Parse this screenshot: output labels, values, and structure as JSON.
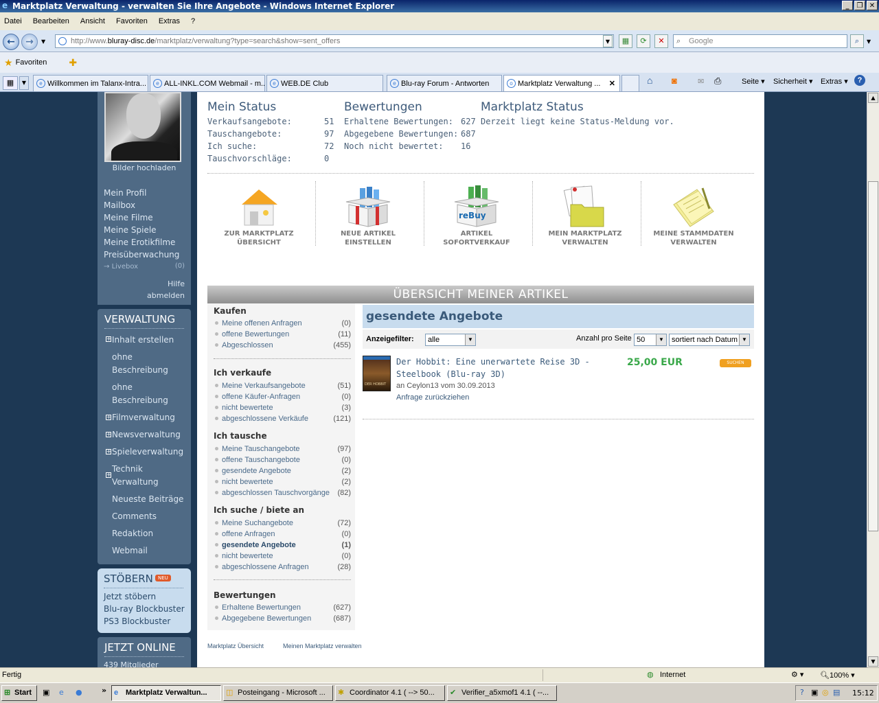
{
  "window": {
    "title": "Marktplatz Verwaltung - verwalten Sie Ihre Angebote - Windows Internet Explorer"
  },
  "menu": [
    "Datei",
    "Bearbeiten",
    "Ansicht",
    "Favoriten",
    "Extras",
    "?"
  ],
  "address": {
    "prefix": "http://www.",
    "domain": "bluray-disc.de",
    "path": "/marktplatz/verwaltung?type=search&show=sent_offers",
    "search_placeholder": "Google"
  },
  "favorites": {
    "label": "Favoriten"
  },
  "tabs": [
    {
      "label": "Willkommen im Talanx-Intra..."
    },
    {
      "label": "ALL-INKL.COM Webmail - m..."
    },
    {
      "label": "WEB.DE Club"
    },
    {
      "label": "Blu-ray Forum - Antworten"
    },
    {
      "label": "Marktplatz Verwaltung ..."
    }
  ],
  "commands": {
    "seite": "Seite",
    "sicherheit": "Sicherheit",
    "extras": "Extras"
  },
  "sidebar": {
    "upload": "Bilder hochladen",
    "links": [
      "Mein Profil",
      "Mailbox",
      "Meine Filme",
      "Meine Spiele",
      "Meine Erotikfilme",
      "Preisüberwachung"
    ],
    "livebox": "Livebox",
    "livebox_count": "(0)",
    "hilfe": "Hilfe",
    "abmelden": "abmelden",
    "verwaltung_title": "VERWALTUNG",
    "verwaltung": [
      "Inhalt erstellen",
      "ohne Beschreibung",
      "ohne Beschreibung",
      "Filmverwaltung",
      "Newsverwaltung",
      "Spieleverwaltung",
      "Technik Verwaltung",
      "Neueste Beiträge",
      "Comments",
      "Redaktion",
      "Webmail"
    ],
    "stoebern_title": "STÖBERN",
    "neu_badge": "NEU",
    "stoebern": [
      "Jetzt stöbern",
      "Blu-ray Blockbuster",
      "PS3 Blockbuster"
    ],
    "online_title": "JETZT ONLINE",
    "online_members": "439 Mitglieder"
  },
  "status": {
    "mein_title": "Mein Status",
    "mein": [
      {
        "label": "Verkaufsangebote:",
        "value": "51"
      },
      {
        "label": "Tauschangebote:",
        "value": "97"
      },
      {
        "label": "Ich suche:",
        "value": "72"
      },
      {
        "label": "Tauschvorschläge:",
        "value": "0"
      }
    ],
    "bew_title": "Bewertungen",
    "bew": [
      {
        "label": "Erhaltene Bewertungen:",
        "value": "627"
      },
      {
        "label": "Abgegebene Bewertungen:",
        "value": "687"
      },
      {
        "label": "Noch nicht bewertet:",
        "value": "16"
      }
    ],
    "mp_title": "Marktplatz Status",
    "mp_text": "Derzeit liegt keine Status-Meldung vor."
  },
  "icons": [
    {
      "line1": "ZUR MARKTPLATZ",
      "line2": "ÜBERSICHT"
    },
    {
      "line1": "NEUE ARTIKEL",
      "line2": "EINSTELLEN"
    },
    {
      "line1": "ARTIKEL",
      "line2": "SOFORTVERKAUF"
    },
    {
      "line1": "MEIN MARKTPLATZ",
      "line2": "VERWALTEN"
    },
    {
      "line1": "MEINE STAMMDATEN",
      "line2": "VERWALTEN"
    }
  ],
  "rebuy_logo": "reBuy",
  "overview_title": "ÜBERSICHT MEINER ARTIKEL",
  "lists": {
    "kaufen_title": "Kaufen",
    "kaufen": [
      {
        "label": "Meine offenen Anfragen",
        "count": "(0)"
      },
      {
        "label": "offene Bewertungen",
        "count": "(11)"
      },
      {
        "label": "Abgeschlossen",
        "count": "(455)"
      }
    ],
    "verkaufe_title": "Ich verkaufe",
    "verkaufe": [
      {
        "label": "Meine Verkaufsangebote",
        "count": "(51)"
      },
      {
        "label": "offene Käufer-Anfragen",
        "count": "(0)"
      },
      {
        "label": "nicht bewertete",
        "count": "(3)"
      },
      {
        "label": "abgeschlossene Verkäufe",
        "count": "(121)"
      }
    ],
    "tausche_title": "Ich tausche",
    "tausche": [
      {
        "label": "Meine Tauschangebote",
        "count": "(97)"
      },
      {
        "label": "offene Tauschangebote",
        "count": "(0)"
      },
      {
        "label": "gesendete Angebote",
        "count": "(2)"
      },
      {
        "label": "nicht bewertete",
        "count": "(2)"
      },
      {
        "label": "abgeschlossen Tauschvorgänge",
        "count": "(82)"
      }
    ],
    "suche_title": "Ich suche / biete an",
    "suche": [
      {
        "label": "Meine Suchangebote",
        "count": "(72)"
      },
      {
        "label": "offene Anfragen",
        "count": "(0)"
      },
      {
        "label": "gesendete Angebote",
        "count": "(1)"
      },
      {
        "label": "nicht bewertete",
        "count": "(0)"
      },
      {
        "label": "abgeschlossene Anfragen",
        "count": "(28)"
      }
    ],
    "bewertungen_title": "Bewertungen",
    "bewertungen": [
      {
        "label": "Erhaltene Bewertungen",
        "count": "(627)"
      },
      {
        "label": "Abgegebene Bewertungen",
        "count": "(687)"
      }
    ]
  },
  "sent": {
    "title": "gesendete Angebote",
    "filter_label": "Anzeigefilter:",
    "filter_value": "alle",
    "perpage_label": "Anzahl pro Seite",
    "perpage_value": "50",
    "sort_value": "sortiert nach Datum"
  },
  "offer": {
    "title": "Der Hobbit: Eine unerwartete Reise 3D - Steelbook (Blu-ray 3D)",
    "meta": "an Ceylon13 vom 30.09.2013",
    "action": "Anfrage zurückziehen",
    "price": "25,00 EUR",
    "badge": "SUCHEN",
    "cover_text": "DER HOBBIT"
  },
  "footer": {
    "link1": "Marktplatz Übersicht",
    "link2": "Meinen Marktplatz verwalten"
  },
  "statusbar": {
    "text": "Fertig",
    "zone": "Internet",
    "zoom": "100%"
  },
  "taskbar": {
    "start": "Start",
    "overflow": "»",
    "items": [
      "Marktplatz Verwaltun...",
      "Posteingang - Microsoft ...",
      "Coordinator 4.1 ( --> 50...",
      "Verifier_a5xmof1 4.1 ( --..."
    ],
    "clock": "15:12"
  },
  "colors": {
    "title_bar": "#0a246a",
    "page_bg": "#1d3854",
    "sidebar": "#4f6a85",
    "price": "#3aa84a",
    "badge": "#f0a020"
  }
}
